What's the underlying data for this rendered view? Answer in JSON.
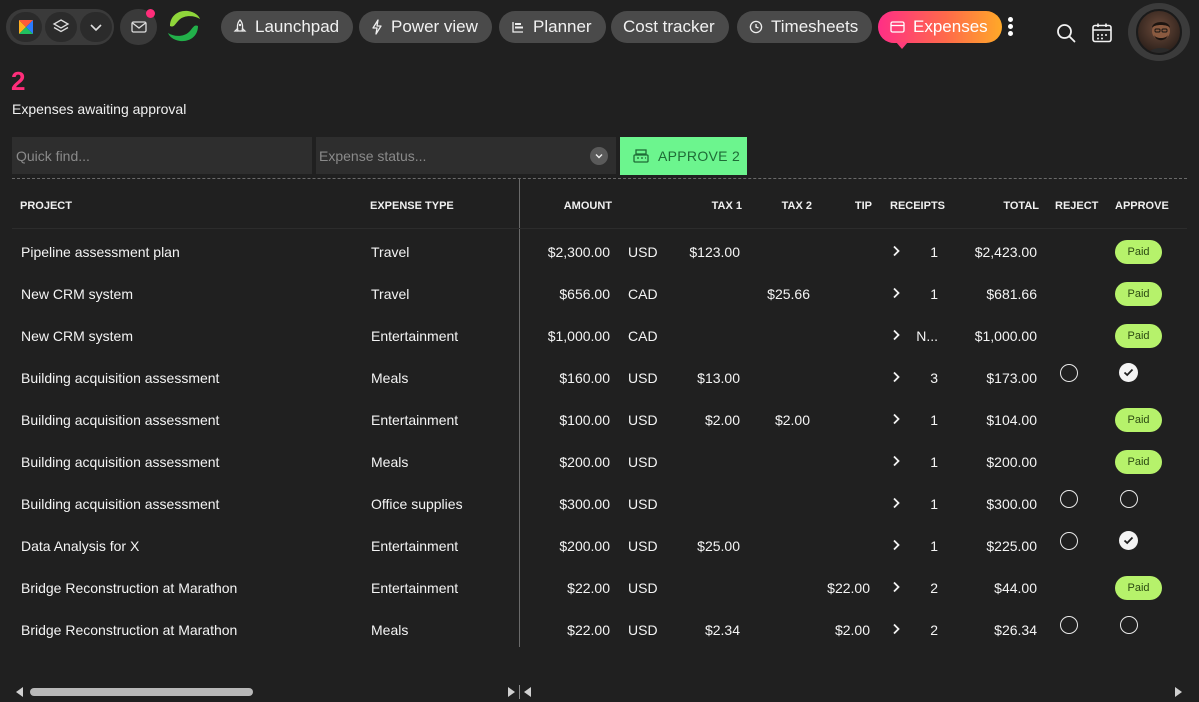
{
  "nav": {
    "tabs": [
      {
        "label": "Launchpad",
        "icon": "rocket-icon"
      },
      {
        "label": "Power view",
        "icon": "bolt-icon"
      },
      {
        "label": "Planner",
        "icon": "planner-icon"
      },
      {
        "label": "Cost tracker",
        "icon": ""
      },
      {
        "label": "Timesheets",
        "icon": "clock-icon"
      },
      {
        "label": "Expenses",
        "icon": "card-icon",
        "active": true
      }
    ],
    "accent_colors": [
      "#ff2e86",
      "#ffa928"
    ]
  },
  "summary": {
    "count": "2",
    "label": "Expenses awaiting approval"
  },
  "filters": {
    "quick_find_placeholder": "Quick find...",
    "status_placeholder": "Expense status...",
    "approve_label": "APPROVE 2"
  },
  "columns": {
    "project": "PROJECT",
    "expense_type": "EXPENSE TYPE",
    "amount": "AMOUNT",
    "tax1": "TAX 1",
    "tax2": "TAX 2",
    "tip": "TIP",
    "receipts": "RECEIPTS",
    "total": "TOTAL",
    "reject": "REJECT",
    "approve": "APPROVE"
  },
  "rows": [
    {
      "project": "Pipeline assessment plan",
      "type": "Travel",
      "amount": "$2,300.00",
      "currency": "USD",
      "tax1": "$123.00",
      "tax2": "",
      "tip": "",
      "receipts": "1",
      "total": "$2,423.00",
      "status": "paid",
      "status_label": "Paid"
    },
    {
      "project": "New CRM system",
      "type": "Travel",
      "amount": "$656.00",
      "currency": "CAD",
      "tax1": "",
      "tax2": "$25.66",
      "tip": "",
      "receipts": "1",
      "total": "$681.66",
      "status": "paid",
      "status_label": "Paid"
    },
    {
      "project": "New CRM system",
      "type": "Entertainment",
      "amount": "$1,000.00",
      "currency": "CAD",
      "tax1": "",
      "tax2": "",
      "tip": "",
      "receipts": "N...",
      "total": "$1,000.00",
      "status": "paid",
      "status_label": "Paid"
    },
    {
      "project": "Building acquisition assessment",
      "type": "Meals",
      "amount": "$160.00",
      "currency": "USD",
      "tax1": "$13.00",
      "tax2": "",
      "tip": "",
      "receipts": "3",
      "total": "$173.00",
      "status": "approved",
      "status_label": ""
    },
    {
      "project": "Building acquisition assessment",
      "type": "Entertainment",
      "amount": "$100.00",
      "currency": "USD",
      "tax1": "$2.00",
      "tax2": "$2.00",
      "tip": "",
      "receipts": "1",
      "total": "$104.00",
      "status": "paid",
      "status_label": "Paid"
    },
    {
      "project": "Building acquisition assessment",
      "type": "Meals",
      "amount": "$200.00",
      "currency": "USD",
      "tax1": "",
      "tax2": "",
      "tip": "",
      "receipts": "1",
      "total": "$200.00",
      "status": "paid",
      "status_label": "Paid"
    },
    {
      "project": "Building acquisition assessment",
      "type": "Office supplies",
      "amount": "$300.00",
      "currency": "USD",
      "tax1": "",
      "tax2": "",
      "tip": "",
      "receipts": "1",
      "total": "$300.00",
      "status": "pending",
      "status_label": ""
    },
    {
      "project": "Data Analysis for X",
      "type": "Entertainment",
      "amount": "$200.00",
      "currency": "USD",
      "tax1": "$25.00",
      "tax2": "",
      "tip": "",
      "receipts": "1",
      "total": "$225.00",
      "status": "approved",
      "status_label": ""
    },
    {
      "project": "Bridge Reconstruction at Marathon",
      "type": "Entertainment",
      "amount": "$22.00",
      "currency": "USD",
      "tax1": "",
      "tax2": "",
      "tip": "$22.00",
      "receipts": "2",
      "total": "$44.00",
      "status": "paid",
      "status_label": "Paid"
    },
    {
      "project": "Bridge Reconstruction at Marathon",
      "type": "Meals",
      "amount": "$22.00",
      "currency": "USD",
      "tax1": "$2.34",
      "tax2": "",
      "tip": "$2.00",
      "receipts": "2",
      "total": "$26.34",
      "status": "pending",
      "status_label": ""
    }
  ]
}
